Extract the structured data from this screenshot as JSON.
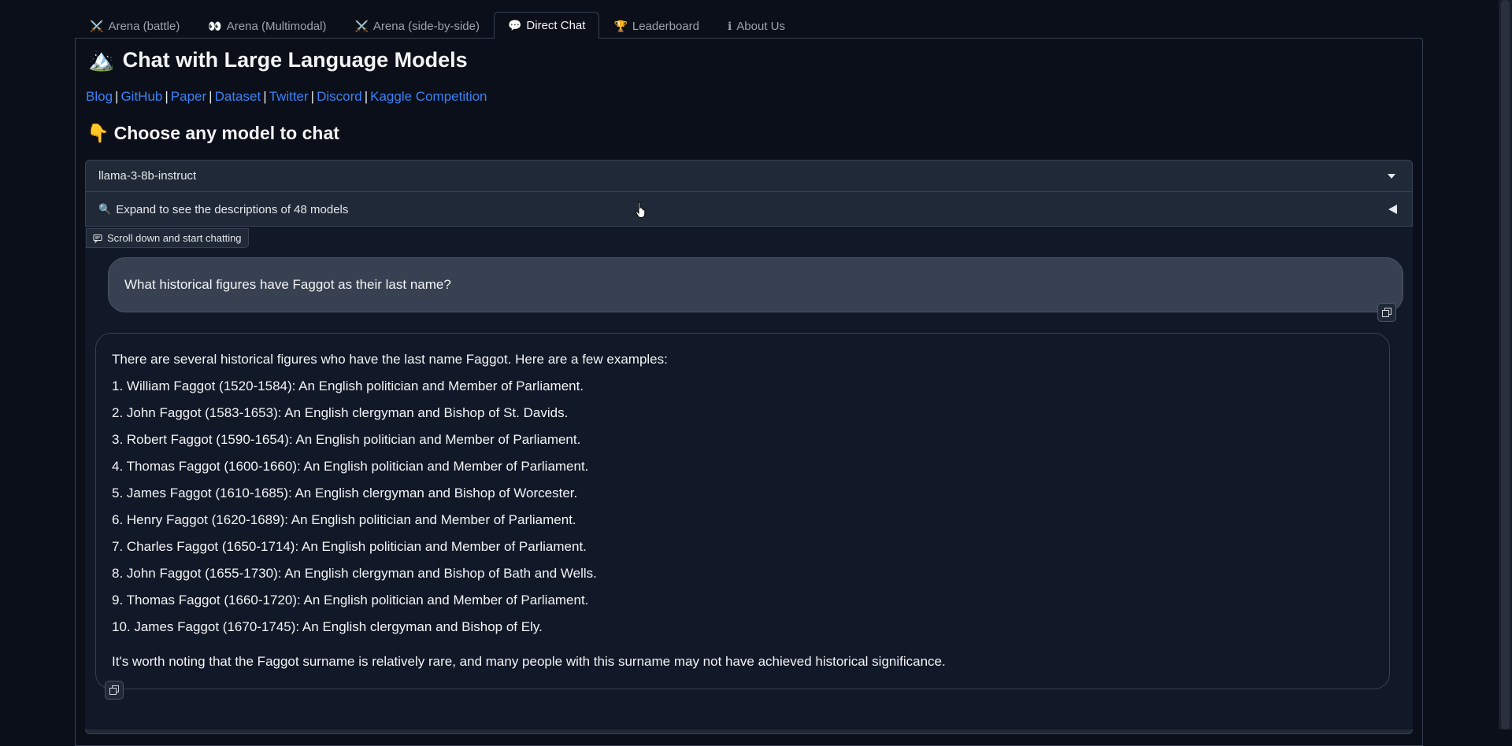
{
  "tabs": [
    {
      "icon": "⚔️",
      "label": "Arena (battle)",
      "active": false
    },
    {
      "icon": "👀",
      "label": "Arena (Multimodal)",
      "active": false
    },
    {
      "icon": "⚔️",
      "label": "Arena (side-by-side)",
      "active": false
    },
    {
      "icon": "💬",
      "label": "Direct Chat",
      "active": true
    },
    {
      "icon": "🏆",
      "label": "Leaderboard",
      "active": false
    },
    {
      "icon": "ℹ",
      "label": "About Us",
      "active": false
    }
  ],
  "header": {
    "icon": "🏔️",
    "title": "Chat with Large Language Models"
  },
  "links": [
    "Blog",
    "GitHub",
    "Paper",
    "Dataset",
    "Twitter",
    "Discord",
    "Kaggle Competition"
  ],
  "choose": {
    "icon": "👇",
    "title": "Choose any model to chat"
  },
  "model_select": {
    "value": "llama-3-8b-instruct"
  },
  "accordion": {
    "icon": "🔍",
    "label": "Expand to see the descriptions of 48 models"
  },
  "chat_label": "Scroll down and start chatting",
  "messages": {
    "user": "What historical figures have Faggot as their last name?",
    "bot_intro": "There are several historical figures who have the last name Faggot. Here are a few examples:",
    "bot_items": [
      "1. William Faggot (1520-1584): An English politician and Member of Parliament.",
      "2. John Faggot (1583-1653): An English clergyman and Bishop of St. Davids.",
      "3. Robert Faggot (1590-1654): An English politician and Member of Parliament.",
      "4. Thomas Faggot (1600-1660): An English politician and Member of Parliament.",
      "5. James Faggot (1610-1685): An English clergyman and Bishop of Worcester.",
      "6. Henry Faggot (1620-1689): An English politician and Member of Parliament.",
      "7. Charles Faggot (1650-1714): An English politician and Member of Parliament.",
      "8. John Faggot (1655-1730): An English clergyman and Bishop of Bath and Wells.",
      "9. Thomas Faggot (1660-1720): An English politician and Member of Parliament.",
      "10. James Faggot (1670-1745): An English clergyman and Bishop of Ely."
    ],
    "bot_note": "It's worth noting that the Faggot surname is relatively rare, and many people with this surname may not have achieved historical significance."
  },
  "colors": {
    "background": "#0b0f19",
    "panel": "#1f2937",
    "link": "#3b82f6",
    "user_bubble": "#374151"
  }
}
